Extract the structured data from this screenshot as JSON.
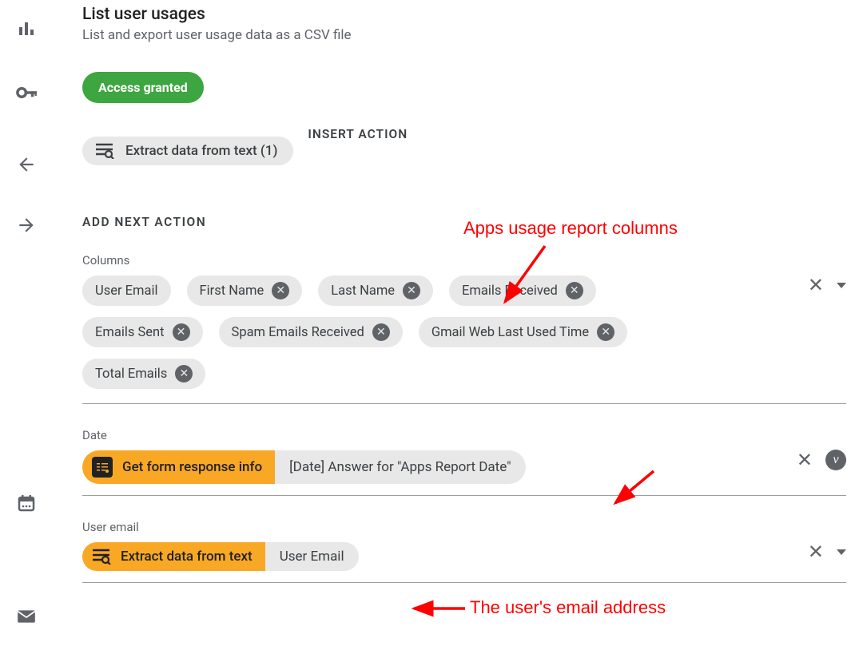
{
  "header": {
    "title": "List user usages",
    "subtitle": "List and export user usage data as a CSV file"
  },
  "access_badge": "Access granted",
  "edit_pill": {
    "label": "Extract data from text (1)"
  },
  "insert_action_label": "INSERT ACTION",
  "add_next_action_heading": "ADD NEXT ACTION",
  "columns_field": {
    "label": "Columns",
    "chips": [
      {
        "label": "User Email",
        "closable": false
      },
      {
        "label": "First Name",
        "closable": true
      },
      {
        "label": "Last Name",
        "closable": true
      },
      {
        "label": "Emails Received",
        "closable": true
      },
      {
        "label": "Emails Sent",
        "closable": true
      },
      {
        "label": "Spam Emails Received",
        "closable": true
      },
      {
        "label": "Gmail Web Last Used Time",
        "closable": true
      },
      {
        "label": "Total Emails",
        "closable": true
      }
    ]
  },
  "date_field": {
    "label": "Date",
    "left": "Get form response info",
    "right": "[Date] Answer for \"Apps Report Date\""
  },
  "user_email_field": {
    "label": "User email",
    "left": "Extract data from text",
    "right": "User Email"
  },
  "annotations": {
    "a1": "Apps usage report columns",
    "a2": "The user's email address"
  }
}
